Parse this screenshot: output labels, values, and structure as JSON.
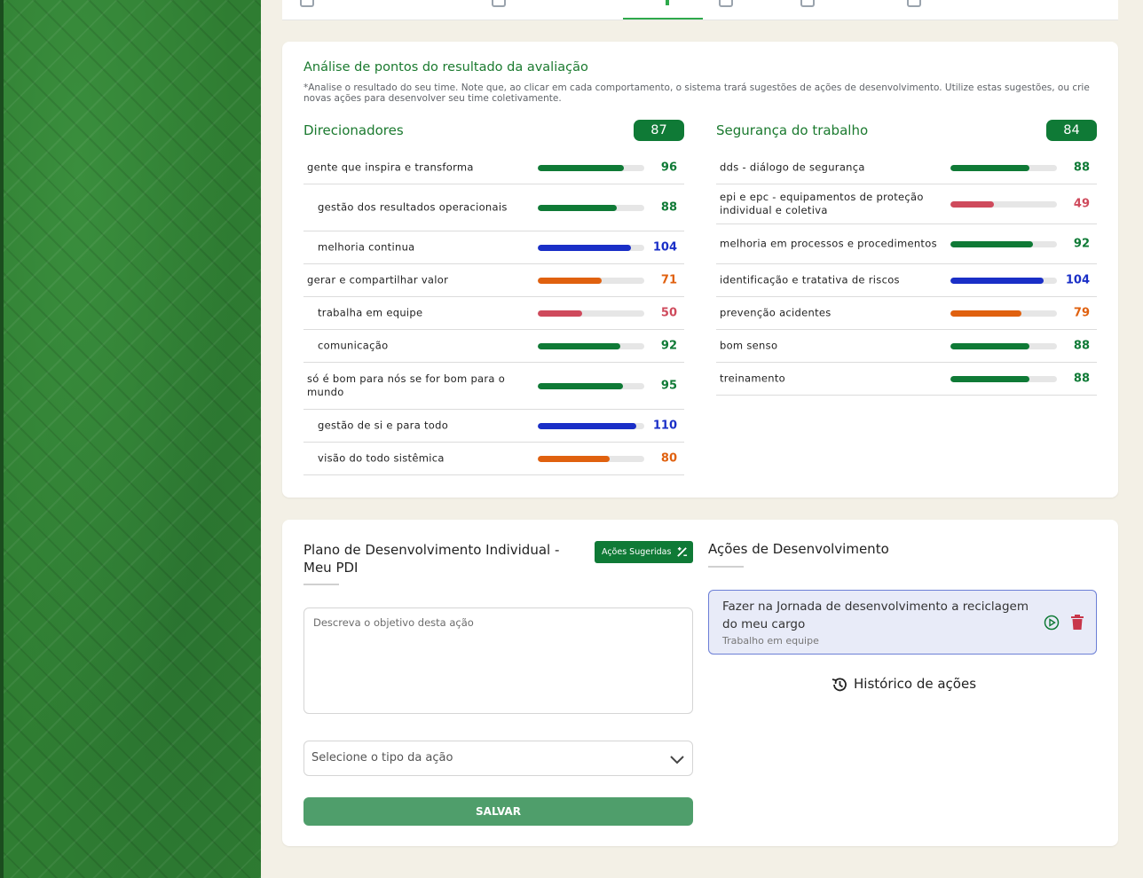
{
  "analysis": {
    "title": "Análise de pontos do resultado da avaliação",
    "note": "*Analise o resultado do seu time. Note que, ao clicar em cada comportamento, o sistema trará sugestões de ações de desenvolvimento. Utilize estas sugestões, ou crie novas ações para desenvolver seu time coletivamente.",
    "columns": [
      {
        "title": "Direcionadores",
        "score": "87",
        "rows": [
          {
            "label": "GENTE QUE INSPIRA E TRANSFORMA",
            "value": "96",
            "level": 0.96,
            "color": "#0f7a36",
            "sub": false,
            "h": 37
          },
          {
            "label": "GESTÃO DOS RESULTADOS OPERACIONAIS",
            "value": "88",
            "level": 0.88,
            "color": "#0f7a36",
            "sub": true,
            "h": 53
          },
          {
            "label": "MELHORIA CONTINUA",
            "value": "104",
            "level": 1.04,
            "color": "#1a2fc7",
            "sub": true,
            "h": 37
          },
          {
            "label": "GERAR E COMPARTILHAR VALOR",
            "value": "71",
            "level": 0.71,
            "color": "#e0610f",
            "sub": false,
            "h": 37
          },
          {
            "label": "TRABALHA EM EQUIPE",
            "value": "50",
            "level": 0.5,
            "color": "#cf4a5c",
            "sub": true,
            "h": 37
          },
          {
            "label": "COMUNICAÇÃO",
            "value": "92",
            "level": 0.92,
            "color": "#0f7a36",
            "sub": true,
            "h": 37
          },
          {
            "label": "SÓ É BOM PARA NÓS SE FOR BOM PARA O MUNDO",
            "value": "95",
            "level": 0.95,
            "color": "#0f7a36",
            "sub": false,
            "h": 53
          },
          {
            "label": "GESTÃO DE SI E PARA TODO",
            "value": "110",
            "level": 1.1,
            "color": "#1a2fc7",
            "sub": true,
            "h": 37
          },
          {
            "label": "VISÃO DO TODO SISTÊMICA",
            "value": "80",
            "level": 0.8,
            "color": "#e0610f",
            "sub": true,
            "h": 37
          }
        ]
      },
      {
        "title": "Segurança do trabalho",
        "score": "84",
        "rows": [
          {
            "label": "DDS - DIÁLOGO DE SEGURANÇA",
            "value": "88",
            "level": 0.88,
            "color": "#0f7a36",
            "sub": false,
            "h": 37
          },
          {
            "label": "EPI E EPC - EQUIPAMENTOS DE PROTEÇÃO INDIVIDUAL E COLETIVA",
            "value": "49",
            "level": 0.49,
            "color": "#cf4a5c",
            "sub": false,
            "h": 45
          },
          {
            "label": "MELHORIA EM PROCESSOS E PROCEDIMENTOS",
            "value": "92",
            "level": 0.92,
            "color": "#0f7a36",
            "sub": false,
            "h": 45
          },
          {
            "label": "IDENTIFICAÇÃO E TRATATIVA DE RISCOS",
            "value": "104",
            "level": 1.04,
            "color": "#1a2fc7",
            "sub": false,
            "h": 37
          },
          {
            "label": "PREVENÇÃO ACIDENTES",
            "value": "79",
            "level": 0.79,
            "color": "#e0610f",
            "sub": false,
            "h": 37
          },
          {
            "label": "BOM SENSO",
            "value": "88",
            "level": 0.88,
            "color": "#0f7a36",
            "sub": false,
            "h": 37
          },
          {
            "label": "TREINAMENTO",
            "value": "88",
            "level": 0.88,
            "color": "#0f7a36",
            "sub": false,
            "h": 37
          }
        ]
      }
    ]
  },
  "pdi": {
    "title": "Plano de Desenvolvimento Individual - Meu PDI",
    "suggest_button": "Ações Sugeridas",
    "objective_placeholder": "Descreva o objetivo desta ação",
    "action_type_placeholder": "Selecione o tipo da ação",
    "save_button": "SALVAR"
  },
  "actions": {
    "title": "Ações de Desenvolvimento",
    "items": [
      {
        "text": "Fazer na Jornada de desenvolvimento a reciclagem do meu cargo",
        "category": "Trabalho em equipe"
      }
    ],
    "history_label": "Histórico de ações"
  },
  "colors": {
    "green": "#0f7a36",
    "blue": "#1a2fc7",
    "orange": "#e0610f",
    "red": "#cf4a5c"
  }
}
